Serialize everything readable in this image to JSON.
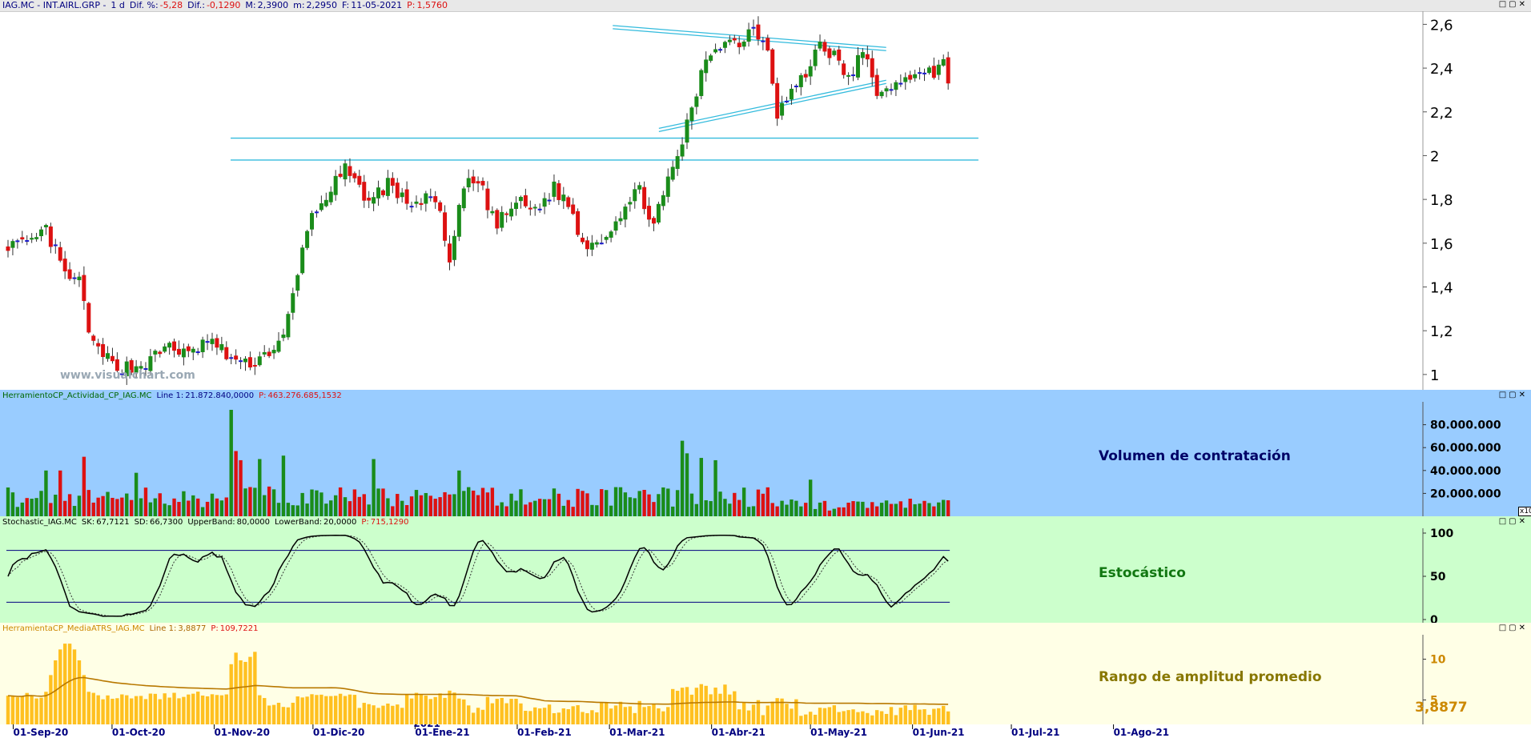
{
  "header": {
    "symbol": "IAG.MC - INT.AIRL.GRP -",
    "period": "1 d",
    "dif_pct_label": "Dif. %:",
    "dif_pct": "-5,28",
    "dif_label": "Dif.:",
    "dif": "-0,1290",
    "max_label": "M:",
    "max": "2,3900",
    "min_label": "m:",
    "min": "2,2950",
    "date_label": "F:",
    "date": "11-05-2021",
    "price_label": "P:",
    "price": "1,5760",
    "window_buttons": "□▢✕"
  },
  "watermark": "www.visualchart.com",
  "volume_panel": {
    "header_name": "HerramientoCP_Actividad_CP_IAG.MC",
    "line_label": "Line 1:",
    "line_value": "21.872.840,0000",
    "p_label": "P:",
    "p_value": "463.276.685,1532",
    "title": "Volumen de contratación",
    "scale_tag": "x10",
    "bg": "#99ccff"
  },
  "stoch_panel": {
    "header_name": "Stochastic_IAG.MC",
    "sk_label": "SK:",
    "sk": "67,7121",
    "sd_label": "SD:",
    "sd": "66,7300",
    "ub_label": "UpperBand:",
    "ub": "80,0000",
    "lb_label": "LowerBand:",
    "lb": "20,0000",
    "p_label": "P:",
    "p": "715,1290",
    "title": "Estocástico",
    "bg": "#ccffcc"
  },
  "atr_panel": {
    "header_name": "HerramientaCP_MediaATRS_IAG.MC",
    "line_label": "Line 1:",
    "line_value": "3,8877",
    "p_label": "P:",
    "p": "109,7221",
    "title": "Rango de amplitud promedio",
    "last_value": "3,8877",
    "bg": "#ffffe6"
  },
  "chart_data": [
    {
      "type": "candlestick",
      "title": "",
      "ylim": [
        0.93,
        2.66
      ],
      "y_ticks": [
        "2,6",
        "2,4",
        "2,2",
        "2",
        "1,8",
        "1,6",
        "1,4",
        "1,2",
        "1"
      ],
      "x_ticks": [
        "01-Sep-20",
        "01-Oct-20",
        "01-Nov-20",
        "01-Dic-20",
        "01-Ene-21",
        "01-Feb-21",
        "01-Mar-21",
        "01-Abr-21",
        "01-May-21",
        "01-Jun-21",
        "01-Jul-21",
        "01-Ago-21"
      ],
      "year_marker": "2021",
      "anchors": [
        [
          0,
          1.6
        ],
        [
          4,
          1.58
        ],
        [
          8,
          1.66
        ],
        [
          12,
          1.45
        ],
        [
          15,
          1.42
        ],
        [
          18,
          1.12
        ],
        [
          22,
          1.05
        ],
        [
          26,
          1.03
        ],
        [
          30,
          1.06
        ],
        [
          34,
          1.14
        ],
        [
          38,
          1.08
        ],
        [
          42,
          1.16
        ],
        [
          46,
          1.09
        ],
        [
          50,
          1.04
        ],
        [
          54,
          1.09
        ],
        [
          58,
          1.16
        ],
        [
          61,
          1.45
        ],
        [
          63,
          1.68
        ],
        [
          67,
          1.82
        ],
        [
          71,
          1.93
        ],
        [
          74,
          1.84
        ],
        [
          77,
          1.8
        ],
        [
          80,
          1.88
        ],
        [
          83,
          1.8
        ],
        [
          87,
          1.78
        ],
        [
          90,
          1.82
        ],
        [
          93,
          1.5
        ],
        [
          96,
          1.86
        ],
        [
          99,
          1.88
        ],
        [
          103,
          1.68
        ],
        [
          107,
          1.79
        ],
        [
          111,
          1.75
        ],
        [
          115,
          1.85
        ],
        [
          118,
          1.78
        ],
        [
          121,
          1.6
        ],
        [
          125,
          1.62
        ],
        [
          129,
          1.74
        ],
        [
          133,
          1.84
        ],
        [
          136,
          1.69
        ],
        [
          139,
          1.87
        ],
        [
          142,
          2.07
        ],
        [
          144,
          2.2
        ],
        [
          147,
          2.45
        ],
        [
          150,
          2.52
        ],
        [
          154,
          2.52
        ],
        [
          157,
          2.59
        ],
        [
          160,
          2.5
        ],
        [
          162,
          2.2
        ],
        [
          165,
          2.29
        ],
        [
          168,
          2.37
        ],
        [
          171,
          2.52
        ],
        [
          174,
          2.45
        ],
        [
          177,
          2.35
        ],
        [
          180,
          2.47
        ],
        [
          183,
          2.3
        ],
        [
          186,
          2.28
        ],
        [
          189,
          2.38
        ],
        [
          192,
          2.36
        ],
        [
          195,
          2.39
        ],
        [
          197,
          2.46
        ],
        [
          198,
          2.33
        ]
      ],
      "trendlines": [
        {
          "kind": "resistance",
          "from": [
            "2021-03-02",
            2.58
          ],
          "to": [
            "2021-05-24",
            2.48
          ]
        },
        {
          "kind": "support",
          "from": [
            "2021-03-16",
            2.11
          ],
          "to": [
            "2021-05-24",
            2.33
          ]
        },
        {
          "kind": "horizontal",
          "from": [
            "2020-11-06",
            2.08
          ],
          "to": [
            "2021-06-21",
            2.08
          ]
        },
        {
          "kind": "horizontal",
          "from": [
            "2020-11-06",
            1.98
          ],
          "to": [
            "2021-06-21",
            1.98
          ]
        }
      ],
      "colors": {
        "up": "#1a8c1a",
        "down": "#dd1111",
        "flat": "#1a1acc",
        "trendline": "#33bbdd"
      }
    },
    {
      "type": "bar",
      "title": "Volumen de contratación",
      "ylim": [
        0,
        100000000
      ],
      "y_ticks": [
        "80.000.000",
        "60.000.000",
        "40.000.000",
        "20.000.000"
      ],
      "y_tick_values": [
        80000000,
        60000000,
        40000000,
        20000000
      ],
      "colors": {
        "up": "#1a8c1a",
        "down": "#dd1111"
      }
    },
    {
      "type": "line",
      "title": "Estocástico",
      "ylim": [
        0,
        100
      ],
      "y_ticks": [
        "100",
        "50",
        "0"
      ],
      "bands": [
        80,
        20
      ],
      "colors": {
        "sk": "#000000",
        "sd": "#333333",
        "band": "#000080"
      }
    },
    {
      "type": "bar",
      "title": "Rango de amplitud promedio",
      "ylim": [
        2,
        13
      ],
      "y_ticks": [
        "10",
        "5"
      ],
      "colors": {
        "bar": "#ffc020",
        "avg": "#b87800"
      }
    }
  ]
}
